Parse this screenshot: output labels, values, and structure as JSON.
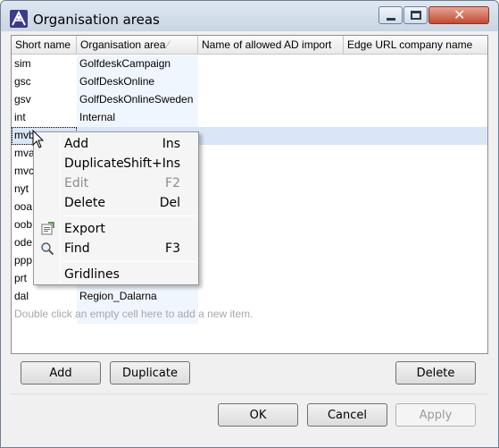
{
  "window": {
    "title": "Organisation areas",
    "app_icon": "ascentia-logo-icon",
    "controls": [
      "minimize-icon",
      "maximize-icon",
      "close-icon"
    ]
  },
  "table": {
    "columns": [
      "Short name",
      "Organisation area",
      "Name of allowed AD import",
      "Edge URL company name"
    ],
    "sort_indicator": "⁄",
    "rows": [
      {
        "short": "sim",
        "area": "GolfdeskCampaign"
      },
      {
        "short": "gsc",
        "area": "GolfDeskOnline"
      },
      {
        "short": "gsv",
        "area": "GolfDeskOnlineSweden"
      },
      {
        "short": "int",
        "area": "Internal"
      },
      {
        "short": "mvb",
        "area": ""
      },
      {
        "short": "mva",
        "area": ""
      },
      {
        "short": "mvc",
        "area": ""
      },
      {
        "short": "nyt",
        "area": ""
      },
      {
        "short": "ooa",
        "area": ""
      },
      {
        "short": "oob",
        "area": ""
      },
      {
        "short": "ode",
        "area": ""
      },
      {
        "short": "ppp",
        "area": ""
      },
      {
        "short": "prt",
        "area": ""
      },
      {
        "short": "dal",
        "area": "Region_Dalarna"
      }
    ],
    "add_hint": "Double click an empty cell here to add a new item."
  },
  "context_menu": {
    "items": [
      {
        "label": "Add",
        "shortcut": "Ins",
        "enabled": true,
        "icon": ""
      },
      {
        "label": "Duplicate",
        "shortcut": "Shift+Ins",
        "enabled": true,
        "icon": ""
      },
      {
        "label": "Edit",
        "shortcut": "F2",
        "enabled": false,
        "icon": ""
      },
      {
        "label": "Delete",
        "shortcut": "Del",
        "enabled": true,
        "icon": ""
      },
      {
        "label": "Export",
        "shortcut": "",
        "enabled": true,
        "icon": "export-icon"
      },
      {
        "label": "Find",
        "shortcut": "F3",
        "enabled": true,
        "icon": "magnifier-icon"
      },
      {
        "label": "Gridlines",
        "shortcut": "",
        "enabled": true,
        "icon": ""
      }
    ]
  },
  "buttons": {
    "add": "Add",
    "duplicate": "Duplicate",
    "delete": "Delete",
    "ok": "OK",
    "cancel": "Cancel",
    "apply": "Apply"
  },
  "colors": {
    "selection": "#d8e6f7",
    "area_column": "#f0f6fe",
    "close_button": "#c24a31"
  }
}
